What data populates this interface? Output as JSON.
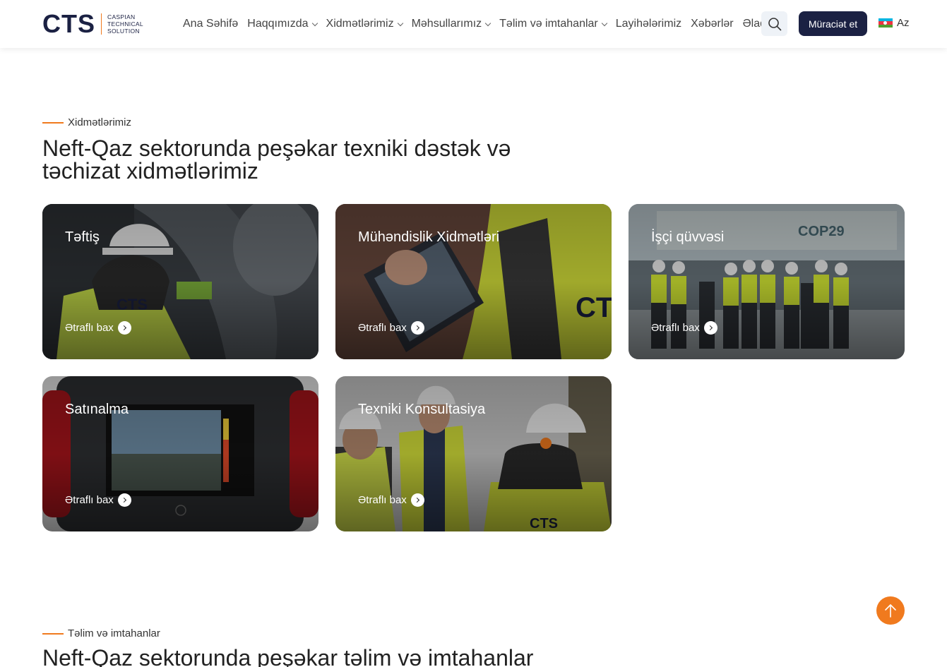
{
  "logo": {
    "mark": "CTS",
    "text_lines": [
      "CASPIAN",
      "TECHNICAL",
      "SOLUTION"
    ]
  },
  "nav": {
    "items": [
      {
        "label": "Ana Səhifə",
        "has_dropdown": false
      },
      {
        "label": "Haqqımızda",
        "has_dropdown": true
      },
      {
        "label": "Xidmətlərimiz",
        "has_dropdown": true
      },
      {
        "label": "Məhsullarımız",
        "has_dropdown": true
      },
      {
        "label": "Təlim və imtahanlar",
        "has_dropdown": true
      },
      {
        "label": "Layihələrimiz",
        "has_dropdown": false
      },
      {
        "label": "Xəbərlər",
        "has_dropdown": false
      },
      {
        "label": "Əlaqə",
        "has_dropdown": false
      }
    ],
    "search_icon": "search-icon",
    "apply_label": "Müraciət et",
    "language": "Az"
  },
  "services": {
    "eyebrow": "Xidmətlərimiz",
    "heading_lines": [
      "Neft-Qaz sektorunda peşəkar texniki dəstək və",
      "təchizat xidmətlərimiz"
    ],
    "cards": [
      {
        "title": "Təftiş",
        "link": "Ətraflı bax"
      },
      {
        "title": "Mühəndislik Xidmətləri",
        "link": "Ətraflı bax"
      },
      {
        "title": "İşçi qüvvəsi",
        "link": "Ətraflı bax"
      },
      {
        "title": "Satınalma",
        "link": "Ətraflı bax"
      },
      {
        "title": "Texniki Konsultasiya",
        "link": "Ətraflı bax"
      }
    ]
  },
  "training": {
    "eyebrow": "Təlim və imtahanlar",
    "heading": "Neft-Qaz sektorunda peşəkar təlim və imtahanlar"
  },
  "colors": {
    "accent": "#f07a1e",
    "navy": "#1b2143"
  }
}
